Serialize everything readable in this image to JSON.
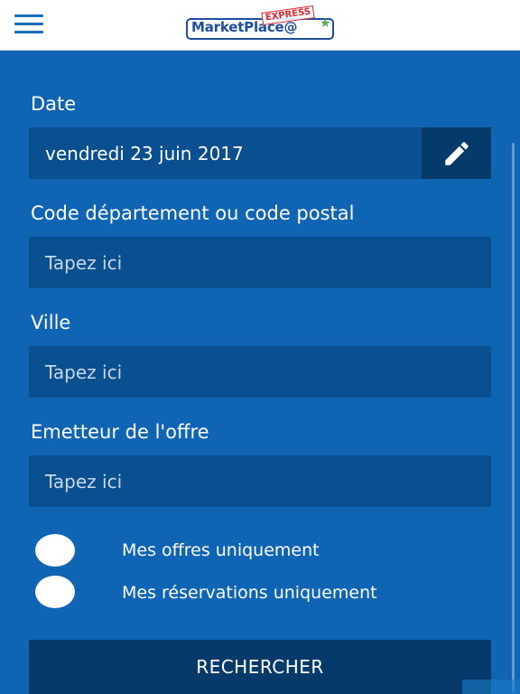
{
  "header": {
    "logo_text": "MarketPlace@",
    "logo_badge": "EXPRESS"
  },
  "form": {
    "date": {
      "label": "Date",
      "value": "vendredi 23 juin 2017"
    },
    "postal": {
      "label": "Code département ou code postal",
      "placeholder": "Tapez ici"
    },
    "city": {
      "label": "Ville",
      "placeholder": "Tapez ici"
    },
    "issuer": {
      "label": "Emetteur de l'offre",
      "placeholder": "Tapez ici"
    },
    "toggles": [
      {
        "label": "Mes offres uniquement"
      },
      {
        "label": "Mes réservations uniquement"
      }
    ],
    "search_label": "RECHERCHER"
  },
  "colors": {
    "background": "#0f65b3",
    "field": "#0a4f8f",
    "button": "#063a6a",
    "logo_blue": "#1c4f9c",
    "logo_red": "#d8262e"
  }
}
